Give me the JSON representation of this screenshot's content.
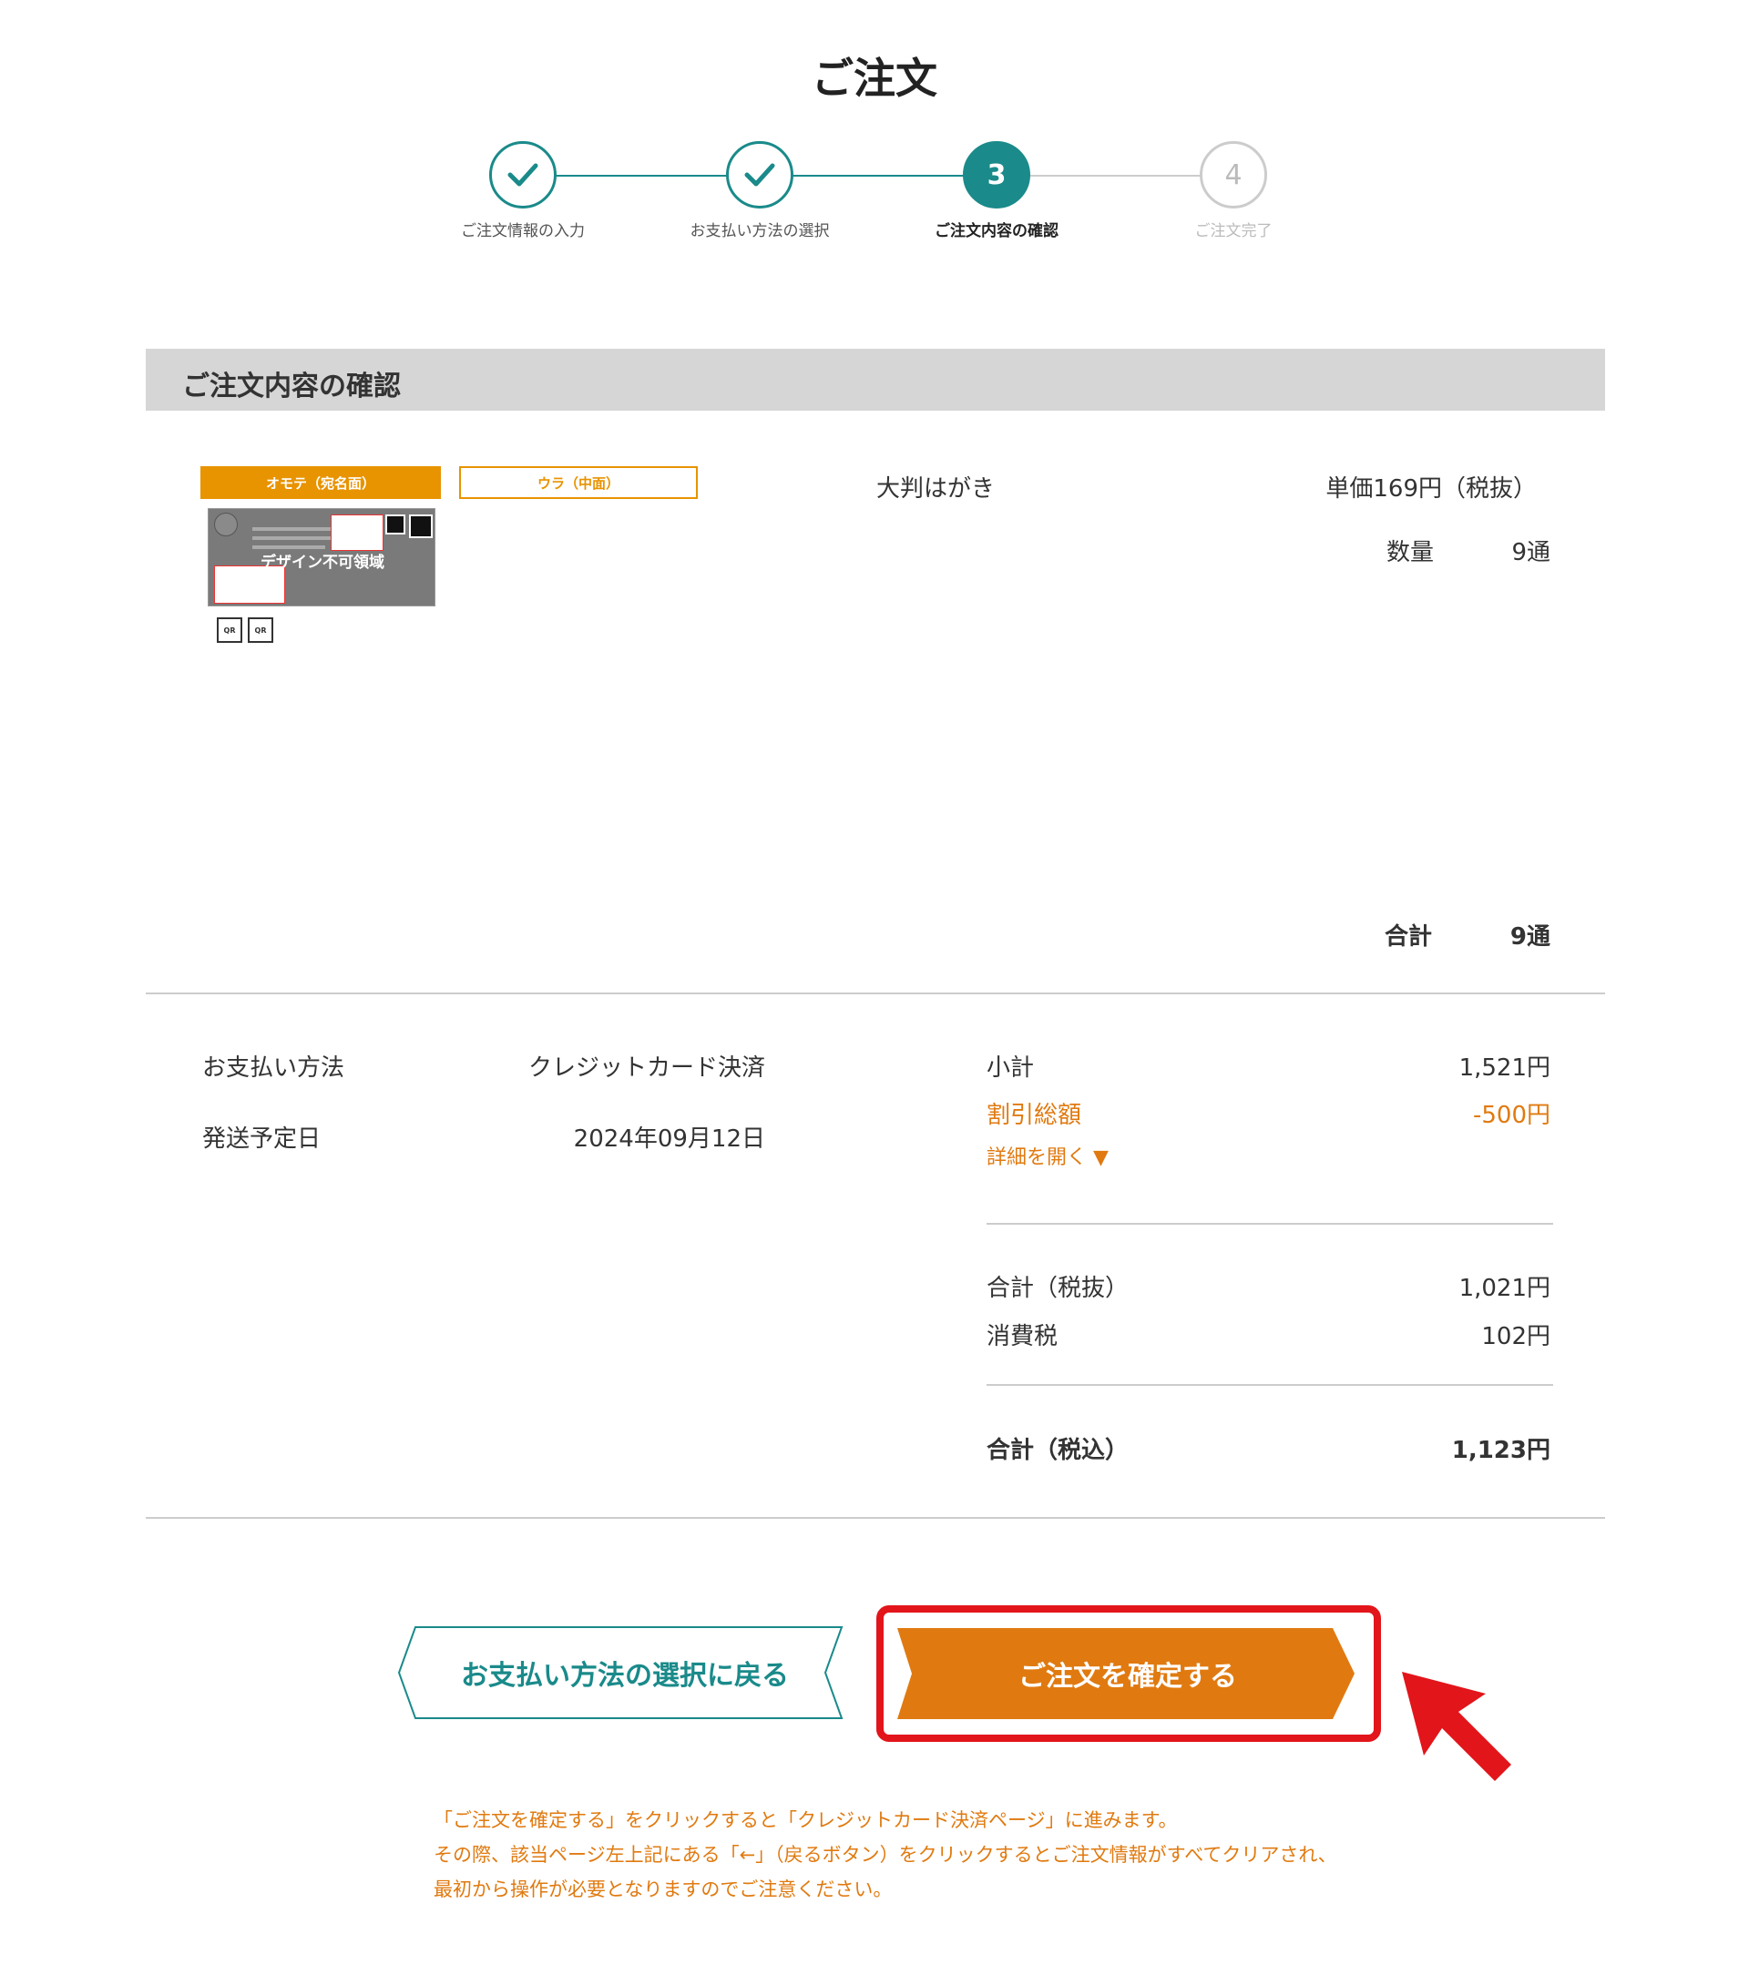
{
  "page_title": "ご注文",
  "steps": [
    {
      "label": "ご注文情報の入力",
      "state": "done"
    },
    {
      "label": "お支払い方法の選択",
      "state": "done"
    },
    {
      "label": "ご注文内容の確認",
      "number": "3",
      "state": "current"
    },
    {
      "label": "ご注文完了",
      "number": "4",
      "state": "todo"
    }
  ],
  "section_title": "ご注文内容の確認",
  "product": {
    "tag_front": "オモテ（宛名面）",
    "tag_back": "ウラ（中面）",
    "preview_label": "デザイン不可領域",
    "qr_text": "QR",
    "name": "大判はがき",
    "unit_price": "単価169円（税抜）",
    "qty_label": "数量",
    "qty_value": "9通"
  },
  "total_qty": {
    "label": "合計",
    "value": "9通"
  },
  "payment": {
    "method_label": "お支払い方法",
    "method_value": "クレジットカード決済",
    "ship_label": "発送予定日",
    "ship_value": "2024年09月12日"
  },
  "summary": {
    "subtotal_label": "小計",
    "subtotal_value": "1,521円",
    "discount_label": "割引総額",
    "discount_value": "-500円",
    "details_toggle": "詳細を開く ▼",
    "total_ex_label": "合計（税抜）",
    "total_ex_value": "1,021円",
    "tax_label": "消費税",
    "tax_value": "102円",
    "total_in_label": "合計（税込）",
    "total_in_value": "1,123円"
  },
  "buttons": {
    "back": "お支払い方法の選択に戻る",
    "confirm": "ご注文を確定する"
  },
  "notice": [
    "「ご注文を確定する」をクリックすると「クレジットカード決済ページ」に進みます。",
    "その際、該当ページ左上記にある「←」（戻るボタン）をクリックするとご注文情報がすべてクリアされ、",
    "最初から操作が必要となりますのでご注意ください。"
  ],
  "colors": {
    "teal": "#1a8a8a",
    "orange": "#e07a10",
    "tag_orange": "#e89300",
    "highlight_red": "#e2151b"
  }
}
